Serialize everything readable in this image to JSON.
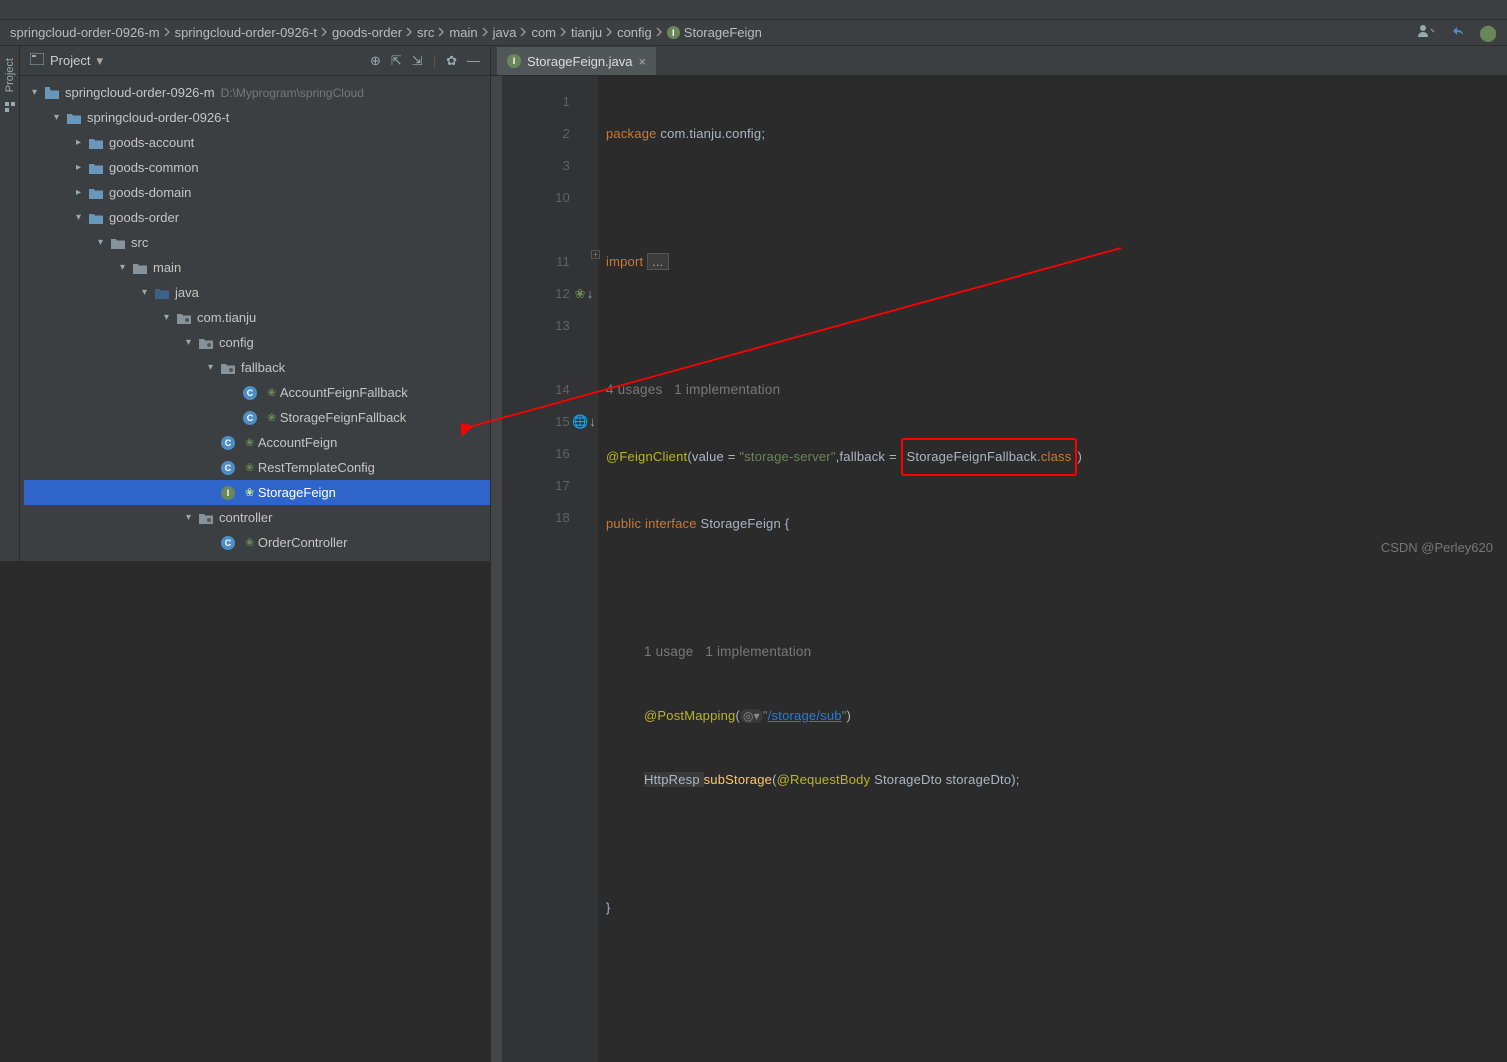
{
  "breadcrumb": {
    "items": [
      "springcloud-order-0926-m",
      "springcloud-order-0926-t",
      "goods-order",
      "src",
      "main",
      "java",
      "com",
      "tianju",
      "config",
      "StorageFeign"
    ],
    "last_icon": "I"
  },
  "side_tab": {
    "label": "Project"
  },
  "project_panel": {
    "title": "Project",
    "root": {
      "name": "springcloud-order-0926-m",
      "path": "D:\\Myprogram\\springCloud"
    },
    "nodes": {
      "t": "springcloud-order-0926-t",
      "acct": "goods-account",
      "common": "goods-common",
      "domain": "goods-domain",
      "order": "goods-order",
      "src": "src",
      "main": "main",
      "java": "java",
      "pkg": "com.tianju",
      "config": "config",
      "fallback": "fallback",
      "afb": "AccountFeignFallback",
      "sfb": "StorageFeignFallback",
      "af": "AccountFeign",
      "rtc": "RestTemplateConfig",
      "sf": "StorageFeign",
      "controller": "controller",
      "oc": "OrderController"
    }
  },
  "editor": {
    "tab_label": "StorageFeign.java",
    "lines": [
      "1",
      "2",
      "3",
      "10",
      "",
      "11",
      "12",
      "13",
      "",
      "14",
      "15",
      "16",
      "17",
      "18"
    ],
    "code": {
      "package_kw": "package ",
      "package_name": "com.tianju.config;",
      "import_kw": "import ",
      "import_dots": "...",
      "usages": "4 usages",
      "impl": "1 implementation",
      "fc_anno": "@FeignClient",
      "fc_open": "(value = ",
      "fc_value": "\"storage-server\"",
      "fc_mid": ",fallback = ",
      "fc_fallback": "StorageFeignFallback.",
      "fc_class": "class",
      "fc_close": ")",
      "public": "public ",
      "interface": "interface ",
      "iface_name": "StorageFeign ",
      "brace_open": "{",
      "usage1": "1 usage",
      "impl1": "1 implementation",
      "pm_anno": "@PostMapping",
      "pm_open": "(",
      "pm_icon": "🔘",
      "pm_url_q1": "\"",
      "pm_url": "/storage/sub",
      "pm_url_q2": "\"",
      "pm_close": ")",
      "ret_type": "HttpResp ",
      "method": "subStorage",
      "method_open": "(",
      "rb_anno": "@RequestBody ",
      "param_type": "StorageDto ",
      "param_name": "storageDto",
      "method_close": ");",
      "brace_close": "}"
    }
  },
  "watermark": "CSDN @Perley620"
}
